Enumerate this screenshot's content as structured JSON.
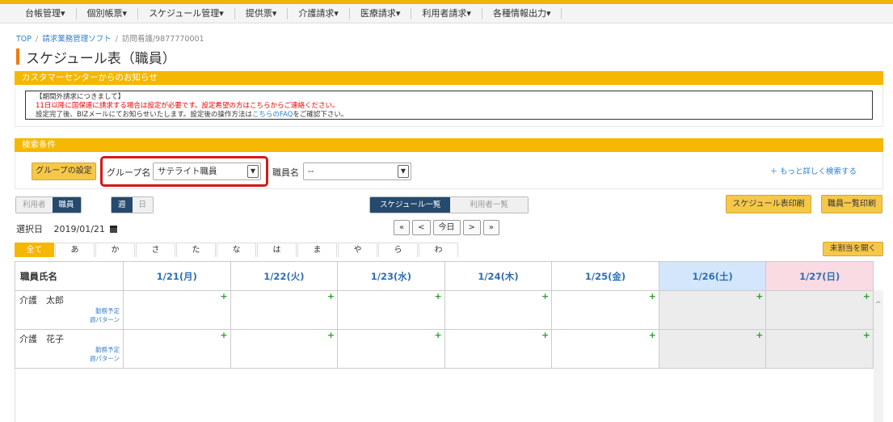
{
  "menu": [
    "台帳管理▾",
    "個別帳票▾",
    "スケジュール管理▾",
    "提供票▾",
    "介護請求▾",
    "医療請求▾",
    "利用者請求▾",
    "各種情報出力▾"
  ],
  "breadcrumb": {
    "top": "TOP",
    "soft": "請求業務管理ソフト",
    "current": "訪問看護/9877770001"
  },
  "page_title": "スケジュール表（職員）",
  "notice": {
    "header": "カスタマーセンターからのお知らせ",
    "heading": "【期間外請求につきまして】",
    "line1": "11日以降に国保連に請求する場合は設定が必要です。設定希望の方はこちらからご連絡ください。",
    "line2_pre": "設定完了後、BIZメールにてお知らせいたします。設定後の操作方法は",
    "line2_link": "こちらのFAQ",
    "line2_post": "をご確認下さい。"
  },
  "search": {
    "header": "検索条件",
    "group_button": "グループの設定",
    "group_label": "グループ名",
    "group_value": "サテライト職員",
    "staff_label": "職員名",
    "staff_value": "--",
    "more_link": "＋ もっと詳しく検索する"
  },
  "toggles": {
    "user": "利用者",
    "staff": "職員",
    "week": "週",
    "day": "日",
    "schedule_list": "スケジュール一覧",
    "user_list": "利用者一覧"
  },
  "print_buttons": {
    "schedule": "スケジュール表印刷",
    "staff": "職員一覧印刷"
  },
  "selected_date": {
    "label": "選択日",
    "value": "2019/01/21"
  },
  "nav_buttons": [
    "«",
    "<",
    "今日",
    ">",
    "»"
  ],
  "kana_tabs": [
    "全て",
    "あ",
    "か",
    "さ",
    "た",
    "な",
    "は",
    "ま",
    "や",
    "ら",
    "わ"
  ],
  "unassigned_button": "未割当を開く",
  "grid": {
    "name_header": "職員氏名",
    "days": [
      "1/21(月)",
      "1/22(火)",
      "1/23(水)",
      "1/24(木)",
      "1/25(金)",
      "1/26(土)",
      "1/27(日)"
    ],
    "add_symbol": "+",
    "staff": [
      {
        "name": "介護　太郎",
        "link1": "勤務予定",
        "link2": "週パターン"
      },
      {
        "name": "介護　花子",
        "link1": "勤務予定",
        "link2": "週パターン"
      }
    ]
  },
  "icons": {
    "calendar": "calendar-icon",
    "scroll_up": "chevron-up-icon"
  },
  "colors": {
    "accent": "#f5b700",
    "title_bar": "#ee7b14",
    "highlight": "#d21a1a",
    "link": "#2f7ec8",
    "toggle_on": "#254a6e"
  }
}
